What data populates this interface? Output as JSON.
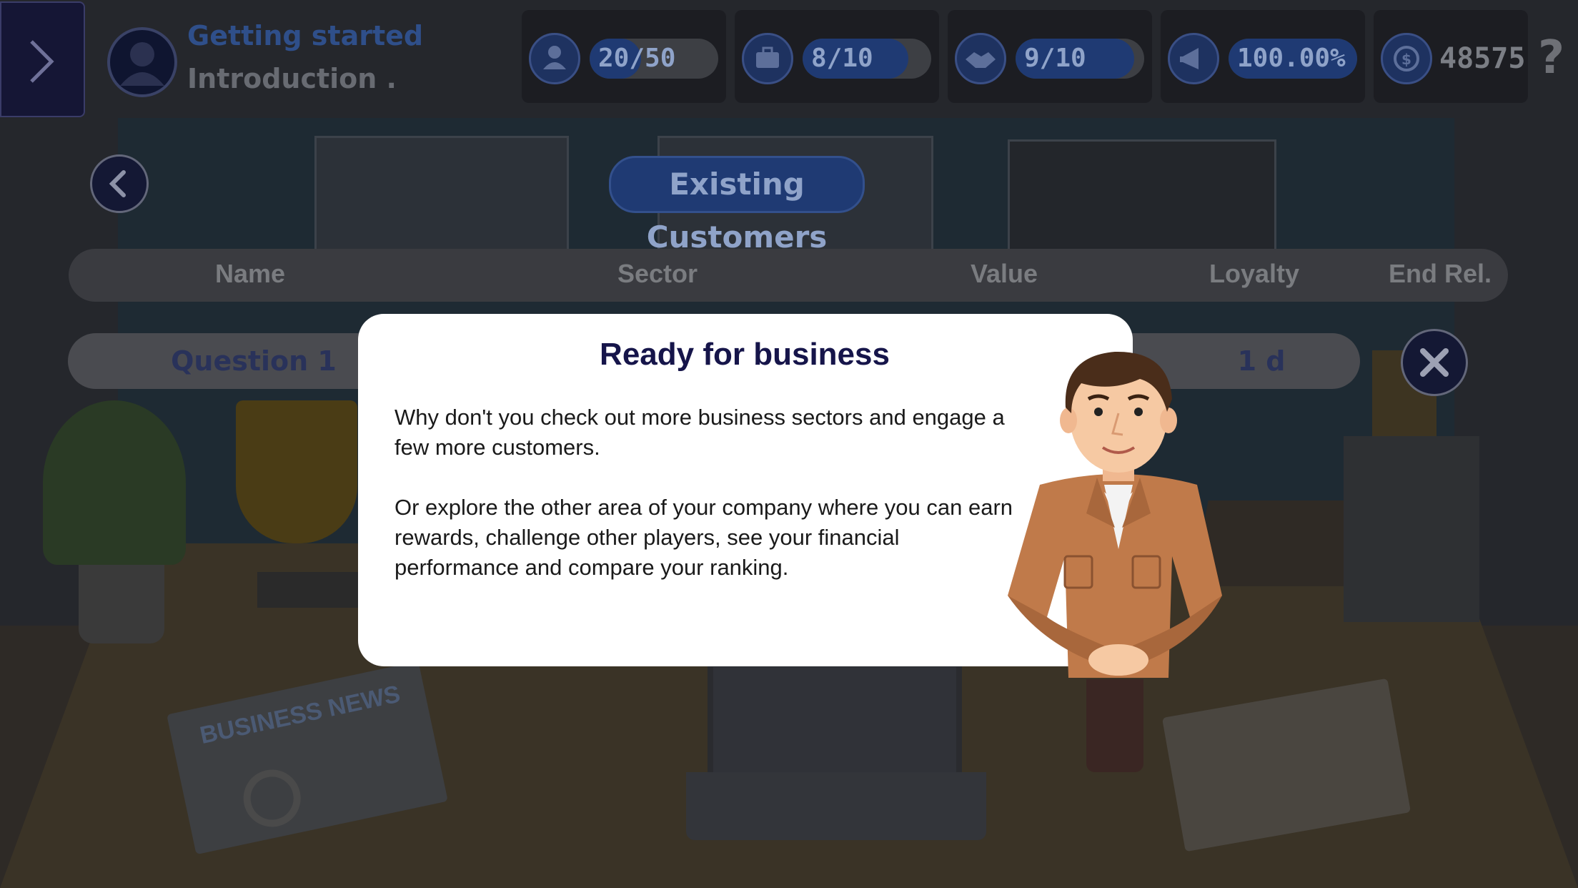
{
  "hud": {
    "menu_toggle_icon": "chevron-right-icon",
    "level_title": "Getting started",
    "level_subtitle": "Introduction .",
    "stats": [
      {
        "icon": "person-icon",
        "value": "20/50",
        "fill": 0.4
      },
      {
        "icon": "briefcase-icon",
        "value": "8/10",
        "fill": 0.8
      },
      {
        "icon": "handshake-icon",
        "value": "9/10",
        "fill": 0.9
      },
      {
        "icon": "megaphone-icon",
        "value": "100.00%",
        "fill": 1.0
      }
    ],
    "coins_icon": "coin-icon",
    "coins": "48575",
    "help_label": "?"
  },
  "panel": {
    "back_icon": "chevron-left-icon",
    "title": "Existing Customers",
    "columns": [
      "Name",
      "Sector",
      "Value",
      "Loyalty",
      "End Rel."
    ],
    "rows": [
      {
        "name": "Question 1",
        "end_rel": "1 d"
      }
    ],
    "close_icon": "close-icon"
  },
  "dialog": {
    "title": "Ready for business",
    "paragraph1": "Why don't you check out more business sectors and engage a few more customers.",
    "paragraph2": "Or explore the other area of your company where you can earn rewards, challenge other players, see your financial performance and compare your ranking.",
    "character": "advisor-character"
  },
  "scene": {
    "newspaper_headline": "BUSINESS NEWS"
  },
  "colors": {
    "accent_blue": "#1f3a73",
    "dialog_title": "#16154a",
    "overlay": "#1b1c22"
  }
}
